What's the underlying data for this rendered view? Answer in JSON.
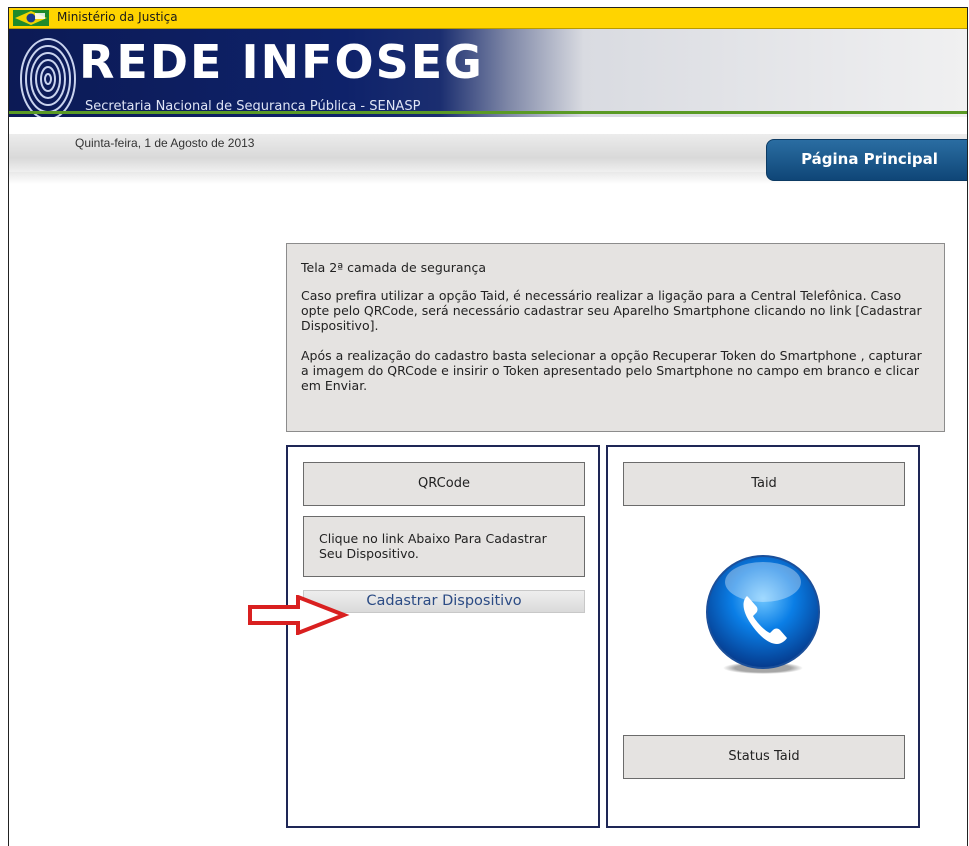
{
  "gov_bar": {
    "title": "Ministério da Justiça"
  },
  "header": {
    "brand_title": "REDE INFOSEG",
    "brand_subtitle": "Secretaria Nacional de Segurança Pública - SENASP"
  },
  "date_bar": {
    "date": "Quinta-feira, 1 de Agosto de 2013",
    "home_button": "Página Principal"
  },
  "info": {
    "title": "Tela 2ª camada de segurança",
    "paragraph1": "Caso prefira utilizar a opção Taid, é necessário realizar a ligação para a Central Telefônica. Caso opte pelo QRCode, será necessário cadastrar seu Aparelho Smartphone clicando no link [Cadastrar Dispositivo].",
    "paragraph2": "Após a realização do cadastro basta selecionar a opção Recuperar Token do Smartphone , capturar a imagem do QRCode e insirir o Token apresentado pelo Smartphone no campo em branco e clicar em Enviar."
  },
  "qrcode_panel": {
    "button": "QRCode",
    "note": "Clique no link Abaixo Para Cadastrar Seu Dispositivo.",
    "link": "Cadastrar Dispositivo"
  },
  "taid_panel": {
    "button": "Taid",
    "icon": "phone-icon",
    "status_button": "Status Taid"
  },
  "colors": {
    "gov_bar": "#ffd400",
    "header_navy": "#0e226a",
    "accent_green": "#5a9a25",
    "panel_border": "#1e2656",
    "arrow_red": "#d92020",
    "link_text": "#2b4b84"
  }
}
